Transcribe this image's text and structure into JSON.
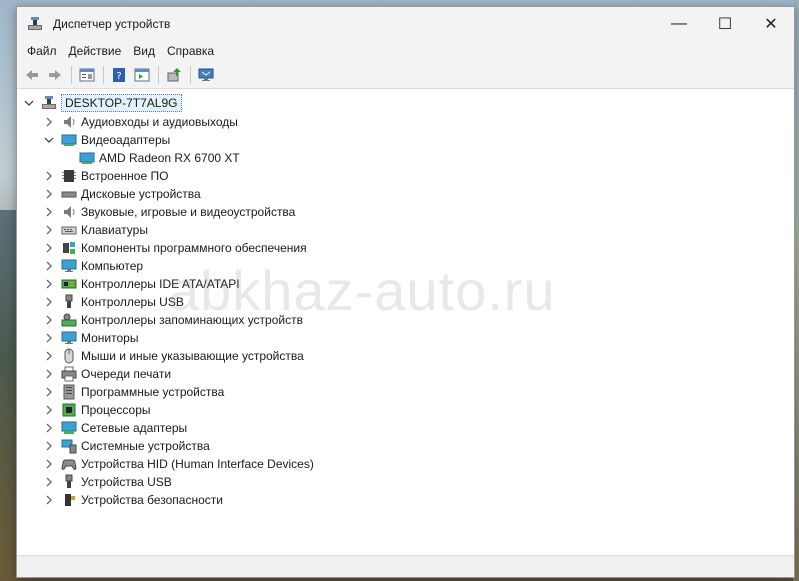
{
  "window": {
    "title": "Диспетчер устройств",
    "controls": {
      "minimize": "—",
      "maximize": "☐",
      "close": "✕"
    }
  },
  "menu": [
    "Файл",
    "Действие",
    "Вид",
    "Справка"
  ],
  "toolbar": [
    "back-icon",
    "forward-icon",
    "properties-icon",
    "help-icon",
    "view-icon",
    "update-driver-icon",
    "monitor-scan-icon"
  ],
  "tree": {
    "root": "DESKTOP-7T7AL9G",
    "categories": [
      {
        "label": "Аудиовходы и аудиовыходы",
        "icon": "speaker-icon",
        "expanded": false
      },
      {
        "label": "Видеоадаптеры",
        "icon": "display-adapter-icon",
        "expanded": true,
        "children": [
          "AMD Radeon RX 6700 XT"
        ]
      },
      {
        "label": "Встроенное ПО",
        "icon": "firmware-icon",
        "expanded": false
      },
      {
        "label": "Дисковые устройства",
        "icon": "disk-drive-icon",
        "expanded": false
      },
      {
        "label": "Звуковые, игровые и видеоустройства",
        "icon": "sound-icon",
        "expanded": false
      },
      {
        "label": "Клавиатуры",
        "icon": "keyboard-icon",
        "expanded": false
      },
      {
        "label": "Компоненты программного обеспечения",
        "icon": "software-component-icon",
        "expanded": false
      },
      {
        "label": "Компьютер",
        "icon": "computer-icon",
        "expanded": false
      },
      {
        "label": "Контроллеры IDE ATA/ATAPI",
        "icon": "ide-controller-icon",
        "expanded": false
      },
      {
        "label": "Контроллеры USB",
        "icon": "usb-icon",
        "expanded": false
      },
      {
        "label": "Контроллеры запоминающих устройств",
        "icon": "storage-controller-icon",
        "expanded": false
      },
      {
        "label": "Мониторы",
        "icon": "monitor-icon",
        "expanded": false
      },
      {
        "label": "Мыши и иные указывающие устройства",
        "icon": "mouse-icon",
        "expanded": false
      },
      {
        "label": "Очереди печати",
        "icon": "printer-icon",
        "expanded": false
      },
      {
        "label": "Программные устройства",
        "icon": "software-device-icon",
        "expanded": false
      },
      {
        "label": "Процессоры",
        "icon": "processor-icon",
        "expanded": false
      },
      {
        "label": "Сетевые адаптеры",
        "icon": "network-adapter-icon",
        "expanded": false
      },
      {
        "label": "Системные устройства",
        "icon": "system-devices-icon",
        "expanded": false
      },
      {
        "label": "Устройства HID (Human Interface Devices)",
        "icon": "hid-icon",
        "expanded": false
      },
      {
        "label": "Устройства USB",
        "icon": "usb-device-icon",
        "expanded": false
      },
      {
        "label": "Устройства безопасности",
        "icon": "security-device-icon",
        "expanded": false
      }
    ]
  },
  "watermark": "abkhaz-auto.ru"
}
